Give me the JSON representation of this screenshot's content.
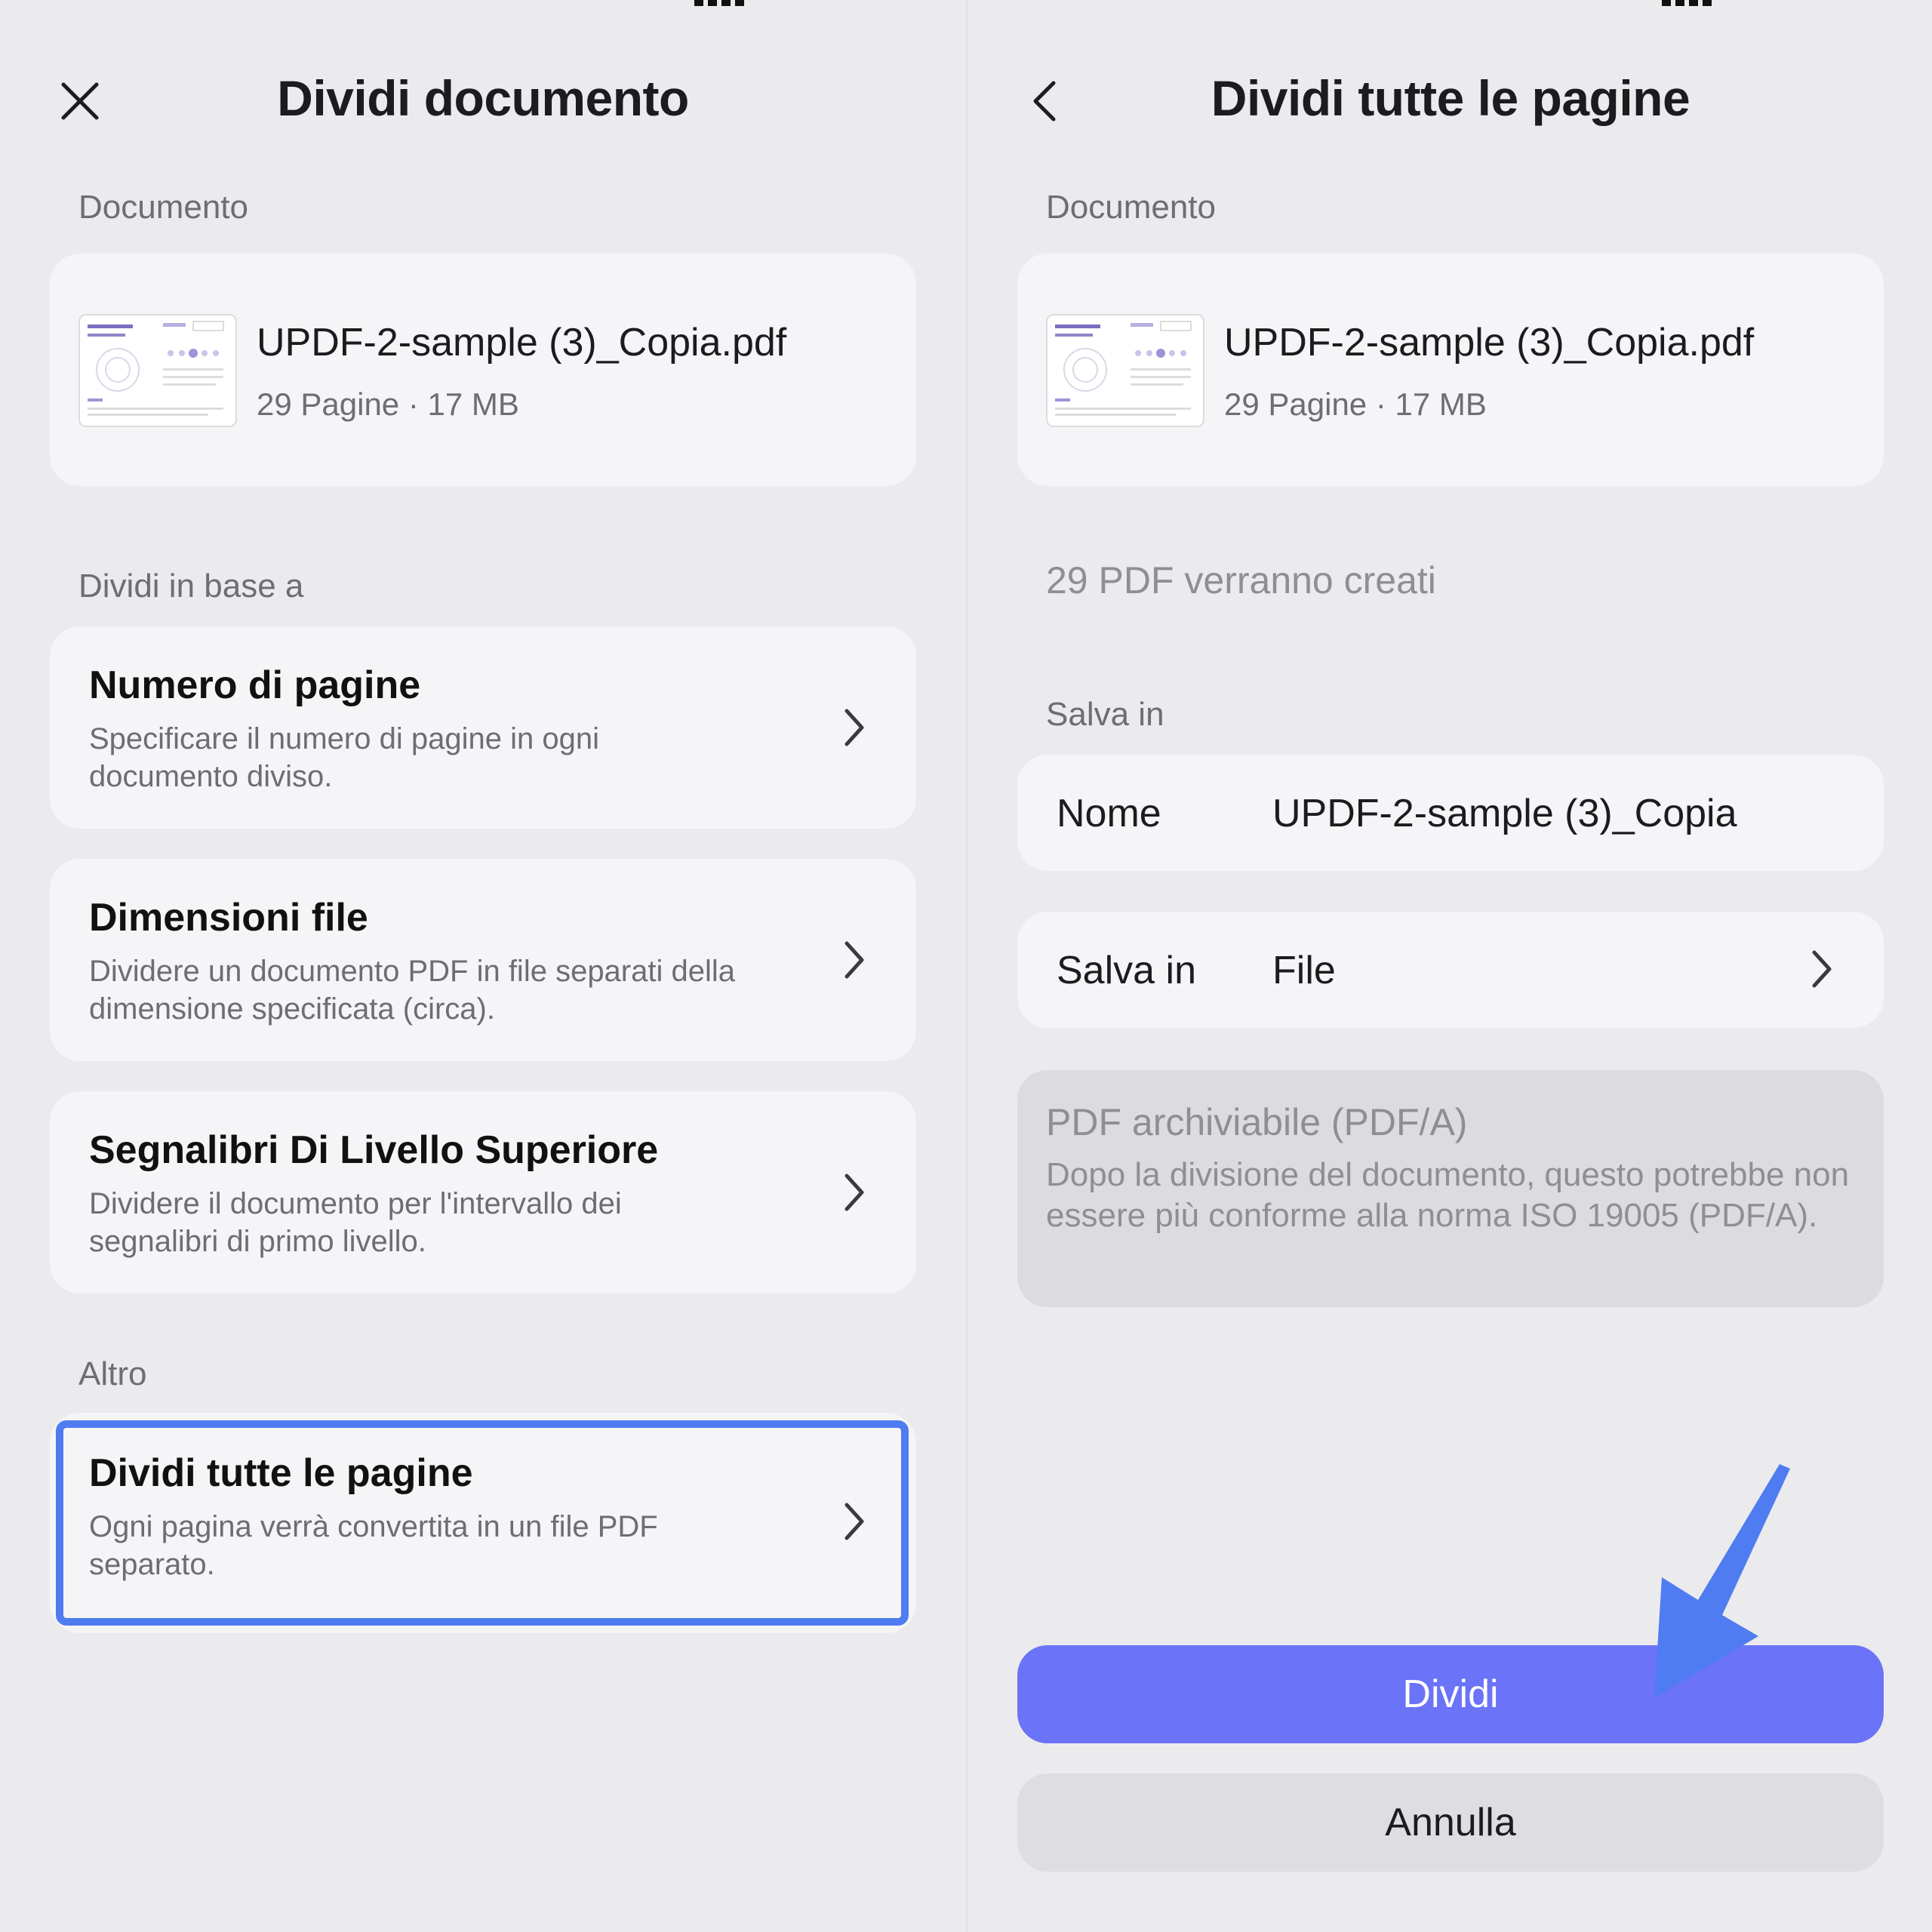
{
  "left": {
    "title": "Dividi documento",
    "document_section_label": "Documento",
    "document": {
      "name": "UPDF-2-sample (3)_Copia.pdf",
      "meta": "29 Pagine · 17 MB"
    },
    "split_by_label": "Dividi in base a",
    "options": [
      {
        "title": "Numero di pagine",
        "desc": "Specificare il numero di pagine in ogni documento diviso."
      },
      {
        "title": "Dimensioni file",
        "desc": "Dividere un documento PDF in file separati della dimensione specificata (circa)."
      },
      {
        "title": "Segnalibri Di Livello Superiore",
        "desc": "Dividere il documento per l'intervallo dei segnalibri di primo livello."
      }
    ],
    "other_label": "Altro",
    "other_option": {
      "title": "Dividi tutte le pagine",
      "desc": "Ogni pagina verrà convertita in un file PDF separato."
    }
  },
  "right": {
    "title": "Dividi tutte le pagine",
    "document_section_label": "Documento",
    "document": {
      "name": "UPDF-2-sample (3)_Copia.pdf",
      "meta": "29 Pagine · 17 MB"
    },
    "count_text": "29 PDF verranno creati",
    "save_section_label": "Salva in",
    "name_row": {
      "label": "Nome",
      "value": "UPDF-2-sample (3)_Copia"
    },
    "save_row": {
      "label": "Salva in",
      "value": "File"
    },
    "pdfa": {
      "title": "PDF archiviabile (PDF/A)",
      "desc": "Dopo la divisione del documento, questo potrebbe non essere più conforme alla norma ISO 19005 (PDF/A)."
    },
    "primary_button": "Dividi",
    "secondary_button": "Annulla"
  },
  "colors": {
    "accent": "#6b73f8",
    "highlight": "#4f7cf0",
    "background": "#ebebee",
    "card": "#f5f5f7"
  },
  "icons": [
    "close-icon",
    "back-icon",
    "chevron-right-icon",
    "pdf-thumbnail"
  ]
}
